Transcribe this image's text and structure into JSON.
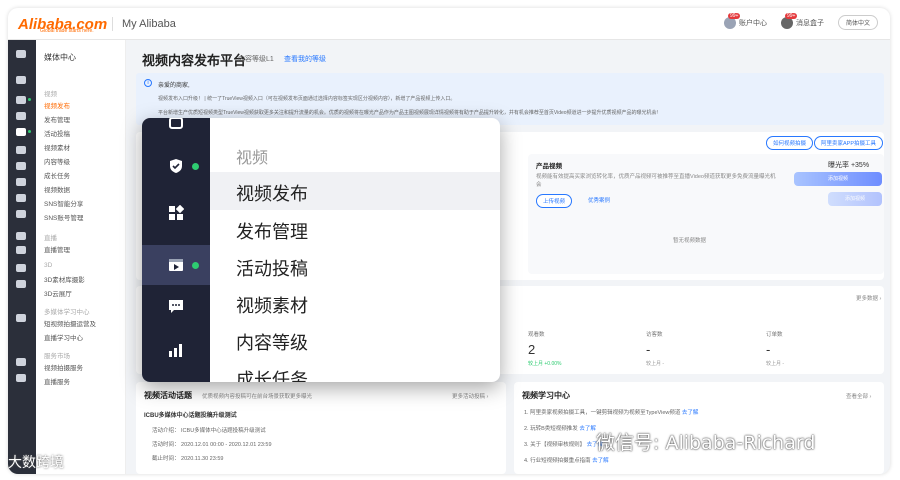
{
  "topbar": {
    "logo": "Alibaba.com",
    "tagline": "Global trade starts here.",
    "title": "My Alibaba",
    "items": [
      {
        "label": "账户中心",
        "badge": "99+"
      },
      {
        "label": "消息盒子",
        "badge": "99+"
      },
      {
        "label": "简体中文"
      }
    ]
  },
  "nav2": {
    "head": "媒体中心",
    "items": [
      {
        "label": "视频",
        "group": true
      },
      {
        "label": "视频发布",
        "active": true
      },
      {
        "label": "发布管理"
      },
      {
        "label": "活动投稿"
      },
      {
        "label": "视频素材"
      },
      {
        "label": "内容等级"
      },
      {
        "label": "成长任务"
      },
      {
        "label": "视频数据"
      },
      {
        "label": "SNS智能分享"
      },
      {
        "label": "SNS账号管理"
      },
      {
        "label": "直播",
        "group": true
      },
      {
        "label": "直播管理"
      },
      {
        "label": "3D",
        "group": true
      },
      {
        "label": "3D素材库摄影"
      },
      {
        "label": "3D云展厅"
      },
      {
        "label": "多媒体学习中心",
        "group": true
      },
      {
        "label": "短视频拍摄运营及"
      },
      {
        "label": "直播学习中心"
      },
      {
        "label": "服务市场",
        "group": true
      },
      {
        "label": "视频拍摄服务"
      },
      {
        "label": "直播服务"
      }
    ]
  },
  "main": {
    "title": "视频内容发布平台",
    "level": "内容等级L1",
    "level_link": "查看我的等级",
    "notice": {
      "title": "亲爱的商家,",
      "lines": [
        "视频发布入口升级！ | 统一了TrueView视频入口（可在视频发布页面通过选择内容标签实现区分视频内容），新增了产品视频上传入口。",
        "平台新增生产优质短视频类型TrueView视频获取更多关注和提升流量的机会。优质的视频将在曝光产品作为产品主图视频展现详情视频将有助于产品提升转化，并有机会推荐至首页Video频道进一步提升优质视频产品的曝光机会!"
      ]
    },
    "buttons": {
      "b1": "如何视频拍摄",
      "b2": "阿里卖家APP拍摄工具"
    },
    "product_video": {
      "title": "产品视频",
      "desc": "视频能有效提高买家浏览转化率，优质产品视频可被推荐至直播Video频道获取更多免费流量曝光机会",
      "upload": "上传视频",
      "secondary": "优秀案例",
      "stat": "曝光率 +35%",
      "btn1": "添加视频",
      "btn2": "添加视频",
      "empty": "暂无视频数据"
    },
    "data_more": "更多数据 ›",
    "stats": [
      {
        "label": "观看数",
        "value": "2",
        "sub": "较上月 +0.00%"
      },
      {
        "label": "访客数",
        "value": "-",
        "sub": "较上月 -"
      },
      {
        "label": "订单数",
        "value": "-",
        "sub": "较上月 -"
      }
    ],
    "activities": {
      "title": "视频活动话题",
      "subtitle": "优质视频内容投稿可在前台场景获取更多曝光",
      "more": "更多活动投稿 ›",
      "topic": "ICBU多媒体中心话题投稿升级测试",
      "lines": [
        "活动介绍： ICBU多媒体中心话题投稿升级测试",
        "活动时间： 2020.12.01 00:00 - 2020.12.01 23:59",
        "截止时间： 2020.11.30 23:59"
      ]
    },
    "learning": {
      "title": "视频学习中心",
      "more": "查看全部 ›",
      "items": [
        {
          "text": "1. 阿里卖家视频拍摄工具，一键剪辑视频为视频至TypeView频道",
          "link": "去了解"
        },
        {
          "text": "2. 玩转B类短视频推发",
          "link": "去了解"
        },
        {
          "text": "3. 关于【视频审核规则】",
          "link": "去了解"
        },
        {
          "text": "4. 行业短视频拍摄重点指南",
          "link": "去了解"
        }
      ]
    }
  },
  "zoom": {
    "items": [
      {
        "label": "视频",
        "group": true
      },
      {
        "label": "视频发布",
        "active": true
      },
      {
        "label": "发布管理"
      },
      {
        "label": "活动投稿"
      },
      {
        "label": "视频素材"
      },
      {
        "label": "内容等级"
      },
      {
        "label": "成长任务"
      }
    ],
    "icons": [
      "shield-icon",
      "grid-icon",
      "video-icon",
      "message-icon",
      "bar-chart-icon"
    ]
  },
  "watermarks": {
    "left": "大数跨境",
    "right": "微信号: Alibaba-Richard"
  },
  "colors": {
    "accent": "#ff6a00",
    "link": "#2878ff",
    "rail": "#2b2f3a",
    "zoom_rail": "#1f2336",
    "online": "#2ecc71"
  }
}
